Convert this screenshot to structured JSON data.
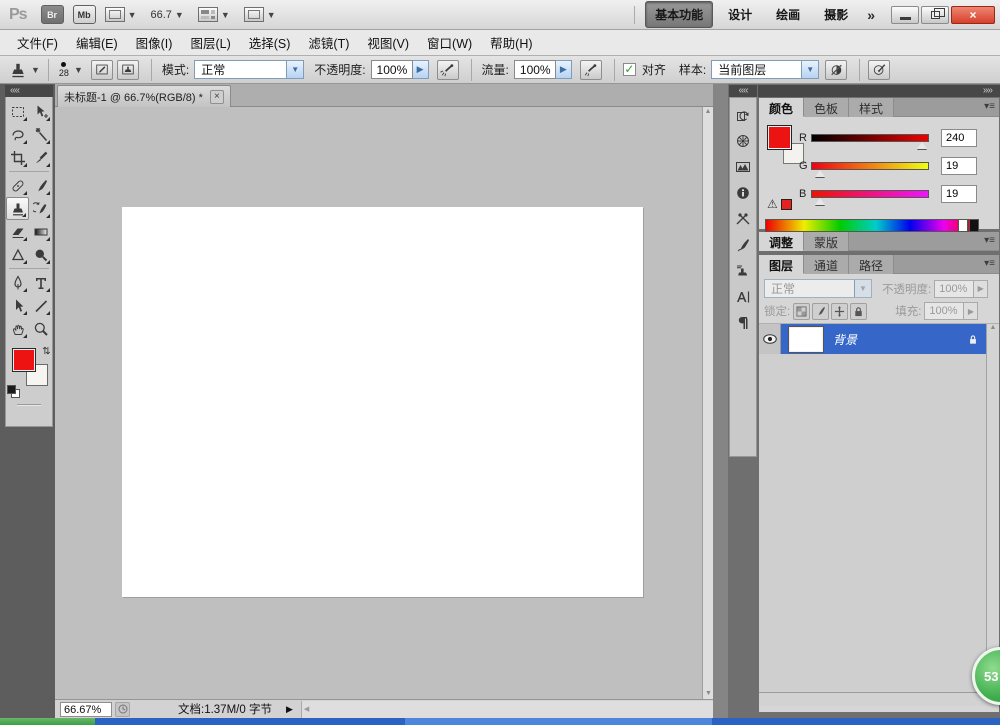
{
  "colors": {
    "foreground_red": "#ee1313",
    "selection_blue": "#3566c8",
    "close_button_red": "#d6402c",
    "taskbar_blue": "#2b63c4",
    "taskbar_green": "#3f9e46",
    "badge_green": "#3fae4e",
    "canvas_gray": "#bfbfbf"
  },
  "titlebar": {
    "logo": "Ps",
    "bridge_button": "Br",
    "minibridge_button": "Mb",
    "zoom_value": "66.7",
    "workspaces": [
      "基本功能",
      "设计",
      "绘画",
      "摄影"
    ],
    "overflow": "»",
    "close_glyph": "×"
  },
  "menubar": {
    "items": [
      "文件(F)",
      "编辑(E)",
      "图像(I)",
      "图层(L)",
      "选择(S)",
      "滤镜(T)",
      "视图(V)",
      "窗口(W)",
      "帮助(H)"
    ]
  },
  "options_bar": {
    "brush_size": "28",
    "mode_label": "模式:",
    "mode_value": "正常",
    "opacity_label": "不透明度:",
    "opacity_value": "100%",
    "flow_label": "流量:",
    "flow_value": "100%",
    "align_check": "✓",
    "align_label": "对齐",
    "sample_label": "样本:",
    "sample_value": "当前图层"
  },
  "document": {
    "tab_title": "未标题-1 @ 66.7%(RGB/8) *",
    "close_glyph": "×"
  },
  "color_panel": {
    "tabs": [
      "颜色",
      "色板",
      "样式"
    ],
    "channels": [
      {
        "label": "R",
        "value": "240"
      },
      {
        "label": "G",
        "value": "19"
      },
      {
        "label": "B",
        "value": "19"
      }
    ]
  },
  "adjustments_panel": {
    "tabs": [
      "调整",
      "蒙版"
    ]
  },
  "layers_panel": {
    "tabs": [
      "图层",
      "通道",
      "路径"
    ],
    "blend_mode": "正常",
    "opacity_label": "不透明度:",
    "opacity_value": "100%",
    "lock_label": "锁定:",
    "fill_label": "填充:",
    "fill_value": "100%",
    "layers": [
      {
        "name": "背景"
      }
    ]
  },
  "status_bar": {
    "zoom": "66.67%",
    "doc_info": "文档:1.37M/0 字节"
  },
  "badge": {
    "value": "53"
  }
}
